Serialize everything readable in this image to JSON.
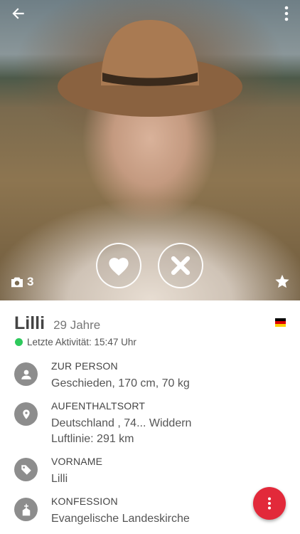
{
  "header": {
    "photo_count": "3"
  },
  "profile": {
    "name": "Lilli",
    "age": "29 Jahre",
    "flag_colors": [
      "#000000",
      "#dd0000",
      "#ffce00"
    ],
    "activity": "Letzte Aktivität: 15:47 Uhr",
    "online_color": "#2ec95c"
  },
  "sections": [
    {
      "icon": "person-icon",
      "label": "ZUR PERSON",
      "value": "Geschieden, 170 cm, 70 kg"
    },
    {
      "icon": "location-pin-icon",
      "label": "AUFENTHALTSORT",
      "value": "Deutschland , 74... Widdern",
      "value2": "Luftlinie: 291 km"
    },
    {
      "icon": "tag-icon",
      "label": "VORNAME",
      "value": "Lilli"
    },
    {
      "icon": "church-icon",
      "label": "KONFESSION",
      "value": "Evangelische Landeskirche"
    }
  ],
  "colors": {
    "accent": "#e2293a",
    "icon_bg": "#8d8d8d"
  }
}
